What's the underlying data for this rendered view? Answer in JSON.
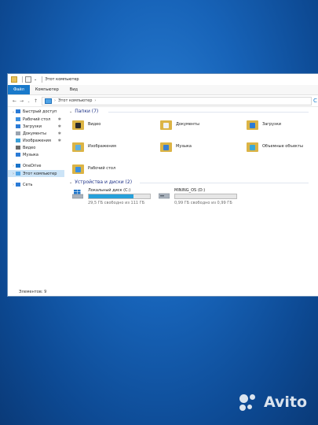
{
  "window": {
    "title": "Этот компьютер",
    "tabs": [
      "Файл",
      "Компьютер",
      "Вид"
    ],
    "address": "Этот компьютер",
    "address_sep": "›",
    "search_fragment": "С"
  },
  "sidebar": {
    "items": [
      {
        "label": "Быстрый доступ",
        "icon": "star-icon",
        "color": "#2b7bd6",
        "chevron": "⌄",
        "pinned": false
      },
      {
        "label": "Рабочий стол",
        "icon": "desktop-icon",
        "color": "#3a8fe0",
        "chevron": "",
        "pinned": true
      },
      {
        "label": "Загрузки",
        "icon": "download-icon",
        "color": "#2b7bd6",
        "chevron": "",
        "pinned": true
      },
      {
        "label": "Документы",
        "icon": "documents-icon",
        "color": "#9aa4b0",
        "chevron": "",
        "pinned": true
      },
      {
        "label": "Изображения",
        "icon": "pictures-icon",
        "color": "#3aa0d8",
        "chevron": "",
        "pinned": true
      },
      {
        "label": "Видео",
        "icon": "video-icon",
        "color": "#6b6b6b",
        "chevron": "",
        "pinned": false
      },
      {
        "label": "Музыка",
        "icon": "music-icon",
        "color": "#2b7bd6",
        "chevron": "",
        "pinned": false
      },
      {
        "label": "OneDrive",
        "icon": "onedrive-icon",
        "color": "#1a73c9",
        "chevron": "›",
        "pinned": false
      },
      {
        "label": "Этот компьютер",
        "icon": "computer-icon",
        "color": "#4fa3e6",
        "chevron": "›",
        "pinned": false
      },
      {
        "label": "Сеть",
        "icon": "network-icon",
        "color": "#2b7bd6",
        "chevron": "›",
        "pinned": false
      }
    ],
    "pin_glyph": "✱"
  },
  "content": {
    "folders_title": "Папки (7)",
    "folders": [
      {
        "label": "Видео",
        "icon": "video-folder-icon",
        "badge": "#2b2b2b"
      },
      {
        "label": "Документы",
        "icon": "documents-folder-icon",
        "badge": "#f2f2f2"
      },
      {
        "label": "Загрузки",
        "icon": "downloads-folder-icon",
        "badge": "#2b7bd6"
      },
      {
        "label": "Изображения",
        "icon": "pictures-folder-icon",
        "badge": "#5fb0e0"
      },
      {
        "label": "Музыка",
        "icon": "music-folder-icon",
        "badge": "#3a7fd0"
      },
      {
        "label": "Объемные объекты",
        "icon": "3d-objects-folder-icon",
        "badge": "#3aa8d8"
      },
      {
        "label": "Рабочий стол",
        "icon": "desktop-folder-icon",
        "badge": "#3a8fe0"
      }
    ],
    "devices_title": "Устройства и диски (2)",
    "drives": [
      {
        "name": "Локальный диск (C:)",
        "free": "29,5 ГБ свободно из 111 ГБ",
        "used_fraction": 0.73,
        "icon": "windows-drive-icon"
      },
      {
        "name": "MINING_OS (D:)",
        "free": "0,99 ГБ свободно из 0,99 ГБ",
        "used_fraction": 0.0,
        "icon": "drive-icon"
      }
    ]
  },
  "status": {
    "items": "Элементов: 9"
  },
  "watermark": {
    "text": "Avito"
  }
}
